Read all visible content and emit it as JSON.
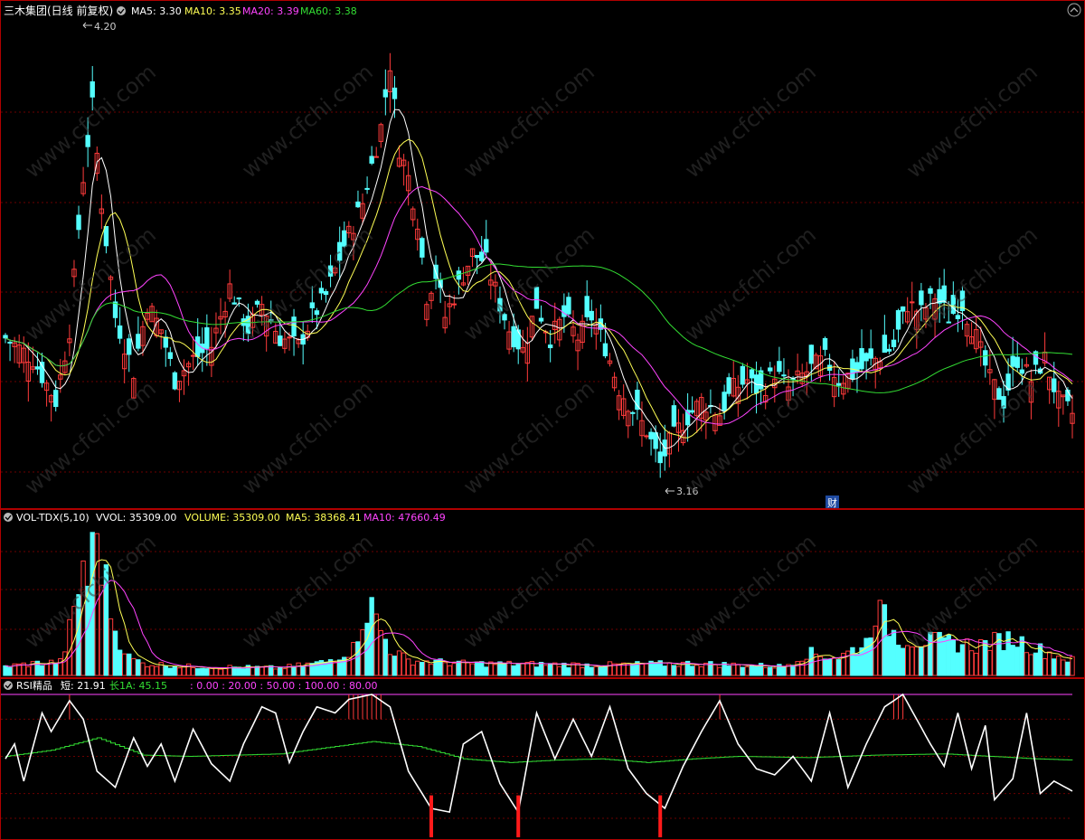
{
  "colors": {
    "up": "#ff3b3b",
    "down": "#54ffff",
    "ma5": "#ffffff",
    "ma10": "#ffff55",
    "ma20": "#ff44ff",
    "ma60": "#33dd33",
    "grid": "#6b0000",
    "frame": "#b00000",
    "rsi_short": "#ffffff",
    "rsi_long": "#33dd33",
    "rsi_spike": "#ff1a1a"
  },
  "watermark": "www.cfchi.com",
  "price_panel": {
    "title": "三木集团(日线 前复权)",
    "legend": [
      {
        "label": "MA5: 3.30",
        "color": "#ffffff"
      },
      {
        "label": "MA10: 3.35",
        "color": "#ffff55"
      },
      {
        "label": "MA20: 3.39",
        "color": "#ff44ff"
      },
      {
        "label": "MA60: 3.38",
        "color": "#33dd33"
      }
    ],
    "high_label": "4.20",
    "low_label": "3.16",
    "event_badge": "财"
  },
  "volume_panel": {
    "title": "VOL-TDX(5,10)",
    "legend": [
      {
        "label": "VVOL: 35309.00",
        "color": "#ffffff"
      },
      {
        "label": "VOLUME: 35309.00",
        "color": "#ffff55"
      },
      {
        "label": "MA5: 38368.41",
        "color": "#ffff55"
      },
      {
        "label": "MA10: 47660.49",
        "color": "#ff44ff"
      }
    ]
  },
  "rsi_panel": {
    "title": "RSI精品",
    "legend": [
      {
        "label": "短: 21.91",
        "color": "#ffffff"
      },
      {
        "label": "长1A: 45.15",
        "color": "#33dd33"
      },
      {
        "label": ": 0.00 : 20.00 : 50.00 : 100.00 : 80.00",
        "color": "#ff44ff"
      }
    ]
  },
  "chart_data": {
    "type": "candlestick",
    "price_ylim": [
      3.1,
      4.25
    ],
    "close_knots": [
      [
        0,
        3.5
      ],
      [
        6,
        3.45
      ],
      [
        11,
        3.35
      ],
      [
        14,
        3.52
      ],
      [
        17,
        3.88
      ],
      [
        19,
        4.05
      ],
      [
        21,
        3.82
      ],
      [
        24,
        3.55
      ],
      [
        28,
        3.42
      ],
      [
        31,
        3.58
      ],
      [
        34,
        3.52
      ],
      [
        37,
        3.4
      ],
      [
        41,
        3.45
      ],
      [
        45,
        3.48
      ],
      [
        49,
        3.62
      ],
      [
        53,
        3.52
      ],
      [
        56,
        3.58
      ],
      [
        60,
        3.5
      ],
      [
        64,
        3.48
      ],
      [
        67,
        3.55
      ],
      [
        70,
        3.6
      ],
      [
        74,
        3.72
      ],
      [
        78,
        3.82
      ],
      [
        82,
        4.0
      ],
      [
        84,
        4.15
      ],
      [
        86,
        3.95
      ],
      [
        88,
        3.88
      ],
      [
        90,
        3.78
      ],
      [
        92,
        3.6
      ],
      [
        94,
        3.65
      ],
      [
        96,
        3.55
      ],
      [
        98,
        3.6
      ],
      [
        102,
        3.7
      ],
      [
        105,
        3.68
      ],
      [
        108,
        3.58
      ],
      [
        110,
        3.52
      ],
      [
        113,
        3.47
      ],
      [
        116,
        3.58
      ],
      [
        119,
        3.5
      ],
      [
        122,
        3.55
      ],
      [
        125,
        3.5
      ],
      [
        128,
        3.55
      ],
      [
        131,
        3.48
      ],
      [
        134,
        3.38
      ],
      [
        137,
        3.33
      ],
      [
        140,
        3.28
      ],
      [
        143,
        3.2
      ],
      [
        145,
        3.25
      ],
      [
        148,
        3.3
      ],
      [
        152,
        3.35
      ],
      [
        156,
        3.32
      ],
      [
        159,
        3.38
      ],
      [
        162,
        3.4
      ],
      [
        165,
        3.37
      ],
      [
        168,
        3.42
      ],
      [
        171,
        3.38
      ],
      [
        175,
        3.42
      ],
      [
        179,
        3.45
      ],
      [
        182,
        3.4
      ],
      [
        186,
        3.42
      ],
      [
        190,
        3.45
      ],
      [
        194,
        3.48
      ],
      [
        197,
        3.58
      ],
      [
        200,
        3.56
      ],
      [
        203,
        3.6
      ],
      [
        206,
        3.55
      ],
      [
        209,
        3.58
      ],
      [
        212,
        3.5
      ],
      [
        215,
        3.4
      ],
      [
        218,
        3.35
      ],
      [
        221,
        3.45
      ],
      [
        224,
        3.4
      ],
      [
        227,
        3.45
      ],
      [
        230,
        3.35
      ],
      [
        233,
        3.32
      ]
    ],
    "volume_knots": [
      [
        0,
        0.06
      ],
      [
        6,
        0.08
      ],
      [
        12,
        0.09
      ],
      [
        15,
        0.4
      ],
      [
        17,
        0.75
      ],
      [
        18,
        0.65
      ],
      [
        20,
        0.95
      ],
      [
        22,
        0.6
      ],
      [
        24,
        0.3
      ],
      [
        27,
        0.12
      ],
      [
        30,
        0.08
      ],
      [
        40,
        0.06
      ],
      [
        60,
        0.05
      ],
      [
        70,
        0.09
      ],
      [
        76,
        0.18
      ],
      [
        78,
        0.4
      ],
      [
        80,
        0.45
      ],
      [
        82,
        0.3
      ],
      [
        84,
        0.18
      ],
      [
        88,
        0.1
      ],
      [
        100,
        0.08
      ],
      [
        130,
        0.07
      ],
      [
        150,
        0.08
      ],
      [
        170,
        0.06
      ],
      [
        175,
        0.15
      ],
      [
        182,
        0.12
      ],
      [
        188,
        0.22
      ],
      [
        190,
        0.45
      ],
      [
        195,
        0.25
      ],
      [
        205,
        0.22
      ],
      [
        212,
        0.2
      ],
      [
        220,
        0.25
      ],
      [
        225,
        0.18
      ],
      [
        233,
        0.1
      ]
    ],
    "rsi_knots": [
      [
        0,
        48
      ],
      [
        2,
        60
      ],
      [
        4,
        30
      ],
      [
        8,
        85
      ],
      [
        10,
        70
      ],
      [
        14,
        95
      ],
      [
        17,
        80
      ],
      [
        20,
        38
      ],
      [
        24,
        25
      ],
      [
        28,
        65
      ],
      [
        31,
        42
      ],
      [
        34,
        60
      ],
      [
        37,
        30
      ],
      [
        41,
        72
      ],
      [
        45,
        44
      ],
      [
        49,
        30
      ],
      [
        52,
        60
      ],
      [
        56,
        90
      ],
      [
        59,
        85
      ],
      [
        62,
        45
      ],
      [
        65,
        70
      ],
      [
        68,
        90
      ],
      [
        72,
        85
      ],
      [
        75,
        96
      ],
      [
        80,
        100
      ],
      [
        84,
        90
      ],
      [
        88,
        38
      ],
      [
        93,
        8
      ],
      [
        97,
        5
      ],
      [
        100,
        60
      ],
      [
        104,
        70
      ],
      [
        108,
        28
      ],
      [
        112,
        5
      ],
      [
        116,
        85
      ],
      [
        120,
        48
      ],
      [
        124,
        80
      ],
      [
        128,
        50
      ],
      [
        132,
        90
      ],
      [
        136,
        40
      ],
      [
        140,
        20
      ],
      [
        144,
        8
      ],
      [
        148,
        42
      ],
      [
        152,
        70
      ],
      [
        156,
        95
      ],
      [
        160,
        60
      ],
      [
        164,
        40
      ],
      [
        168,
        35
      ],
      [
        172,
        50
      ],
      [
        176,
        30
      ],
      [
        180,
        85
      ],
      [
        184,
        25
      ],
      [
        188,
        60
      ],
      [
        192,
        90
      ],
      [
        196,
        100
      ],
      [
        199,
        80
      ],
      [
        202,
        60
      ],
      [
        205,
        42
      ],
      [
        208,
        85
      ],
      [
        211,
        40
      ],
      [
        214,
        75
      ],
      [
        216,
        15
      ],
      [
        220,
        32
      ],
      [
        223,
        85
      ],
      [
        226,
        20
      ],
      [
        229,
        30
      ],
      [
        233,
        22
      ]
    ],
    "rsi_long_knots": [
      [
        0,
        50
      ],
      [
        10,
        55
      ],
      [
        20,
        65
      ],
      [
        30,
        51
      ],
      [
        40,
        50
      ],
      [
        60,
        52
      ],
      [
        80,
        62
      ],
      [
        90,
        58
      ],
      [
        100,
        48
      ],
      [
        110,
        45
      ],
      [
        120,
        47
      ],
      [
        130,
        48
      ],
      [
        140,
        45
      ],
      [
        150,
        48
      ],
      [
        160,
        50
      ],
      [
        175,
        49
      ],
      [
        190,
        51
      ],
      [
        205,
        52
      ],
      [
        215,
        50
      ],
      [
        225,
        48
      ],
      [
        233,
        47
      ]
    ],
    "rsi_levels": [
      0,
      20,
      50,
      100,
      80
    ]
  }
}
